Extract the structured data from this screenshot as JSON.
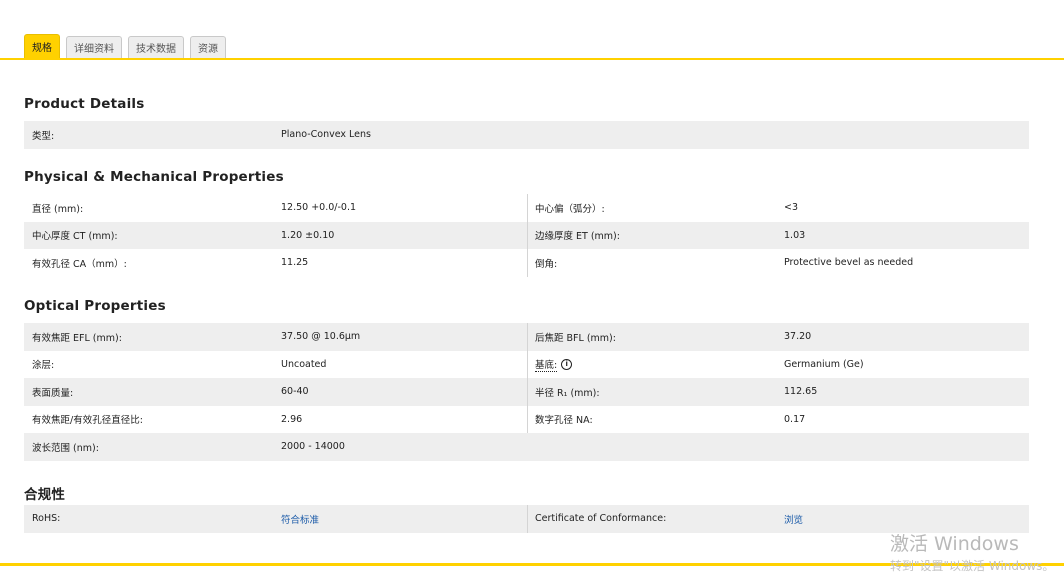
{
  "tabs": [
    {
      "label": "规格",
      "active": true
    },
    {
      "label": "详细资料",
      "active": false
    },
    {
      "label": "技术数据",
      "active": false
    },
    {
      "label": "资源",
      "active": false
    }
  ],
  "sections": {
    "product_details": {
      "title": "Product Details",
      "rows": [
        {
          "label": "类型:",
          "value": "Plano-Convex Lens"
        }
      ]
    },
    "physical": {
      "title": "Physical & Mechanical Properties",
      "rows": [
        {
          "label": "直径 (mm):",
          "value": "12.50 +0.0/-0.1",
          "label2": "中心偏（弧分）:",
          "value2": "<3"
        },
        {
          "label": "中心厚度 CT (mm):",
          "value": "1.20 ±0.10",
          "label2": "边缘厚度 ET (mm):",
          "value2": "1.03"
        },
        {
          "label": "有效孔径 CA（mm）:",
          "value": "11.25",
          "label2": "倒角:",
          "value2": "Protective bevel as needed"
        }
      ]
    },
    "optical": {
      "title": "Optical Properties",
      "rows": [
        {
          "label": "有效焦距 EFL (mm):",
          "value": "37.50 @ 10.6μm",
          "label2": "后焦距 BFL (mm):",
          "value2": "37.20"
        },
        {
          "label": "涂层:",
          "value": "Uncoated",
          "label2": "基底:",
          "value2": "Germanium (Ge)"
        },
        {
          "label": "表面质量:",
          "value": "60-40",
          "label2": "半径 R₁ (mm):",
          "value2": "112.65"
        },
        {
          "label": "有效焦距/有效孔径直径比:",
          "value": "2.96",
          "label2": "数字孔径 NA:",
          "value2": "0.17"
        },
        {
          "label": "波长范围 (nm):",
          "value": "2000 - 14000"
        }
      ]
    },
    "compliance": {
      "title": "合规性",
      "rows": [
        {
          "label": "RoHS:",
          "value": "符合标准",
          "label2": "Certificate of Conformance:",
          "value2": "浏览"
        }
      ]
    }
  },
  "watermark": {
    "title": "激活 Windows",
    "subtitle": "转到\"设置\"以激活 Windows。"
  },
  "colors": {
    "accent": "#ffd100",
    "row_shade": "#eeeeee",
    "link": "#1a5aa8"
  }
}
